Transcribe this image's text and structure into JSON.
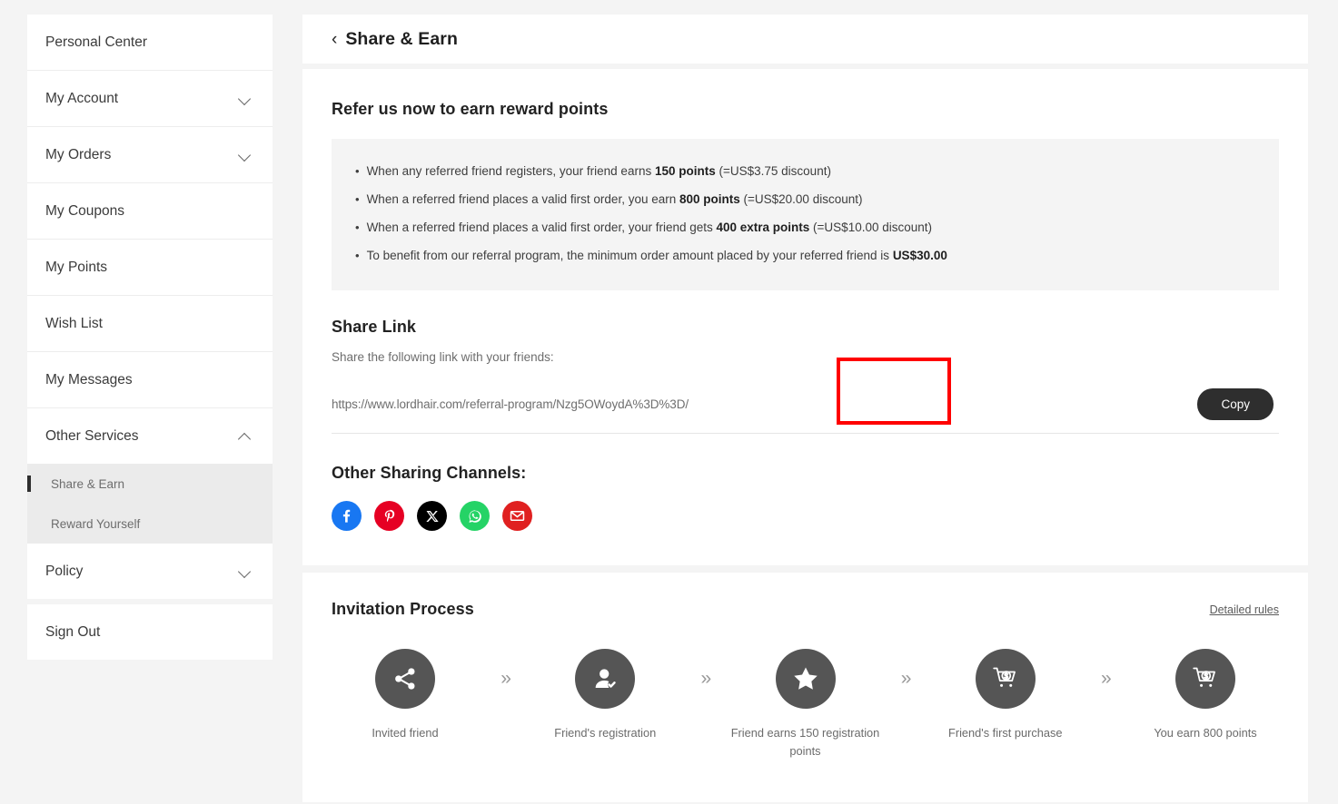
{
  "sidebar": {
    "items": [
      {
        "label": "Personal Center",
        "type": "item",
        "chevron": "none"
      },
      {
        "label": "My Account",
        "type": "item",
        "chevron": "down"
      },
      {
        "label": "My Orders",
        "type": "item",
        "chevron": "down"
      },
      {
        "label": "My Coupons",
        "type": "item",
        "chevron": "none"
      },
      {
        "label": "My Points",
        "type": "item",
        "chevron": "none"
      },
      {
        "label": "Wish List",
        "type": "item",
        "chevron": "none"
      },
      {
        "label": "My Messages",
        "type": "item",
        "chevron": "none"
      },
      {
        "label": "Other Services",
        "type": "item",
        "chevron": "up"
      },
      {
        "label": "Share & Earn",
        "type": "sub",
        "active": true
      },
      {
        "label": "Reward Yourself",
        "type": "sub",
        "active": false
      },
      {
        "label": "Policy",
        "type": "item",
        "chevron": "down"
      },
      {
        "label": "Sign Out",
        "type": "item",
        "chevron": "none"
      }
    ]
  },
  "header": {
    "back_icon": "chevron-left-icon",
    "back_glyph": "‹",
    "title": "Share & Earn"
  },
  "refer": {
    "title": "Refer us now to earn reward points",
    "bullet_glyph": "•",
    "rules": [
      {
        "pre": "When any referred friend registers, your friend earns ",
        "bold": "150 points",
        "post": " (=US$3.75 discount)"
      },
      {
        "pre": "When a referred friend places a valid first order, you earn ",
        "bold": "800 points",
        "post": " (=US$20.00 discount)"
      },
      {
        "pre": "When a referred friend places a valid first order, your friend gets ",
        "bold": "400 extra points",
        "post": " (=US$10.00 discount)"
      },
      {
        "pre": "To benefit from our referral program, the minimum order amount placed by your referred friend is ",
        "bold": "US$30.00",
        "post": ""
      }
    ]
  },
  "share_link": {
    "title": "Share Link",
    "subtitle": "Share the following link with your friends:",
    "url": "https://www.lordhair.com/referral-program/Nzg5OWoydA%3D%3D/",
    "copy_label": "Copy",
    "highlight_color": "#ff0000"
  },
  "channels": {
    "title": "Other Sharing Channels:",
    "items": [
      {
        "name": "facebook-icon",
        "color": "#1877f2"
      },
      {
        "name": "pinterest-icon",
        "color": "#e60023"
      },
      {
        "name": "x-twitter-icon",
        "color": "#000000"
      },
      {
        "name": "whatsapp-icon",
        "color": "#25d366"
      },
      {
        "name": "email-icon",
        "color": "#e02020"
      }
    ]
  },
  "invitation": {
    "title": "Invitation Process",
    "detailed_rules": "Detailed rules",
    "arrow_glyph": "»",
    "steps": [
      {
        "label": "Invited friend",
        "icon": "share-nodes-icon"
      },
      {
        "label": "Friend's registration",
        "icon": "user-check-icon"
      },
      {
        "label": "Friend earns 150 registration points",
        "icon": "star-icon"
      },
      {
        "label": "Friend's first purchase",
        "icon": "cart-dollar-icon"
      },
      {
        "label": "You earn 800 points",
        "icon": "cart-dollar-icon"
      }
    ]
  }
}
